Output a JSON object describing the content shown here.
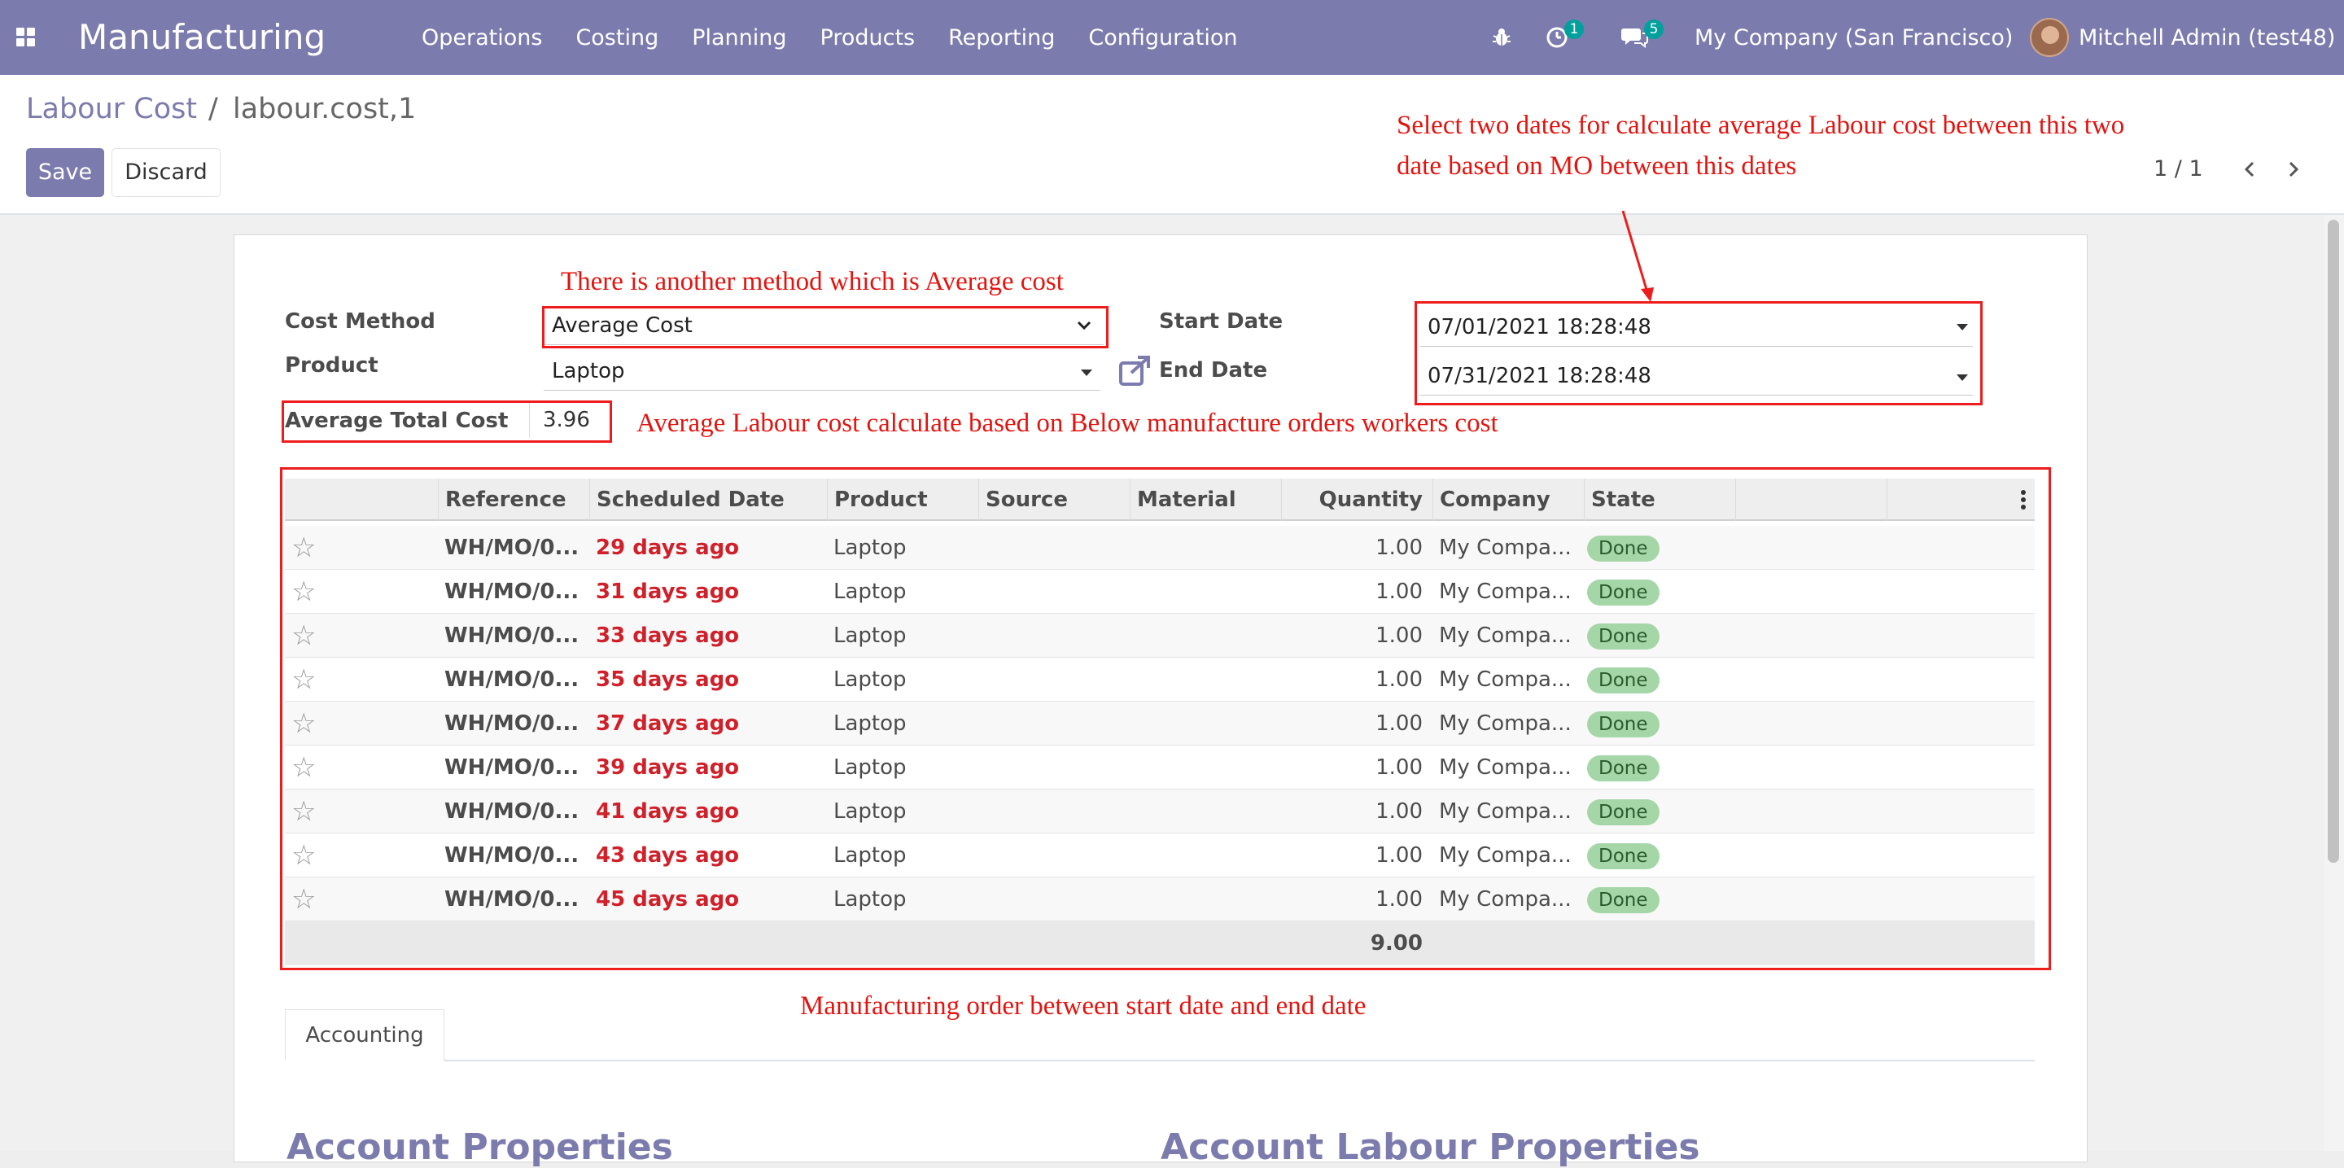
{
  "navbar": {
    "app_name": "Manufacturing",
    "menu": [
      "Operations",
      "Costing",
      "Planning",
      "Products",
      "Reporting",
      "Configuration"
    ],
    "activity_count": "1",
    "message_count": "5",
    "company": "My Company (San Francisco)",
    "user": "Mitchell Admin (test48)",
    "bg_color": "#7c7bad"
  },
  "breadcrumb": {
    "parent": "Labour Cost",
    "separator": "/",
    "current": "labour.cost,1"
  },
  "buttons": {
    "save": "Save",
    "discard": "Discard"
  },
  "pager": {
    "value": "1 / 1"
  },
  "form": {
    "cost_method_label": "Cost Method",
    "cost_method_value": "Average Cost",
    "product_label": "Product",
    "product_value": "Laptop",
    "start_date_label": "Start Date",
    "start_date_value": "07/01/2021 18:28:48",
    "end_date_label": "End Date",
    "end_date_value": "07/31/2021 18:28:48",
    "avg_total_label": "Average Total Cost",
    "avg_total_value": "3.96"
  },
  "annotations": {
    "method": "There is another method which is Average cost",
    "dates_line1": "Select two dates for calculate average Labour cost between this two",
    "dates_line2": "date based on MO between this dates",
    "average": "Average Labour cost calculate based on Below manufacture orders workers cost",
    "orders": "Manufacturing order between start date and end date",
    "color": "#e3140f"
  },
  "table": {
    "columns": [
      "Reference",
      "Scheduled Date",
      "Product",
      "Source",
      "Material A...",
      "Quantity",
      "Company",
      "State"
    ],
    "rows": [
      {
        "ref": "WH/MO/0...",
        "date": "29 days ago",
        "product": "Laptop",
        "qty": "1.00",
        "company": "My Compa...",
        "state": "Done"
      },
      {
        "ref": "WH/MO/0...",
        "date": "31 days ago",
        "product": "Laptop",
        "qty": "1.00",
        "company": "My Compa...",
        "state": "Done"
      },
      {
        "ref": "WH/MO/0...",
        "date": "33 days ago",
        "product": "Laptop",
        "qty": "1.00",
        "company": "My Compa...",
        "state": "Done"
      },
      {
        "ref": "WH/MO/0...",
        "date": "35 days ago",
        "product": "Laptop",
        "qty": "1.00",
        "company": "My Compa...",
        "state": "Done"
      },
      {
        "ref": "WH/MO/0...",
        "date": "37 days ago",
        "product": "Laptop",
        "qty": "1.00",
        "company": "My Compa...",
        "state": "Done"
      },
      {
        "ref": "WH/MO/0...",
        "date": "39 days ago",
        "product": "Laptop",
        "qty": "1.00",
        "company": "My Compa...",
        "state": "Done"
      },
      {
        "ref": "WH/MO/0...",
        "date": "41 days ago",
        "product": "Laptop",
        "qty": "1.00",
        "company": "My Compa...",
        "state": "Done"
      },
      {
        "ref": "WH/MO/0...",
        "date": "43 days ago",
        "product": "Laptop",
        "qty": "1.00",
        "company": "My Compa...",
        "state": "Done"
      },
      {
        "ref": "WH/MO/0...",
        "date": "45 days ago",
        "product": "Laptop",
        "qty": "1.00",
        "company": "My Compa...",
        "state": "Done"
      }
    ],
    "total_quantity": "9.00"
  },
  "tabs": [
    "Accounting"
  ],
  "sections": {
    "left": "Account Properties",
    "right": "Account Labour Properties"
  }
}
